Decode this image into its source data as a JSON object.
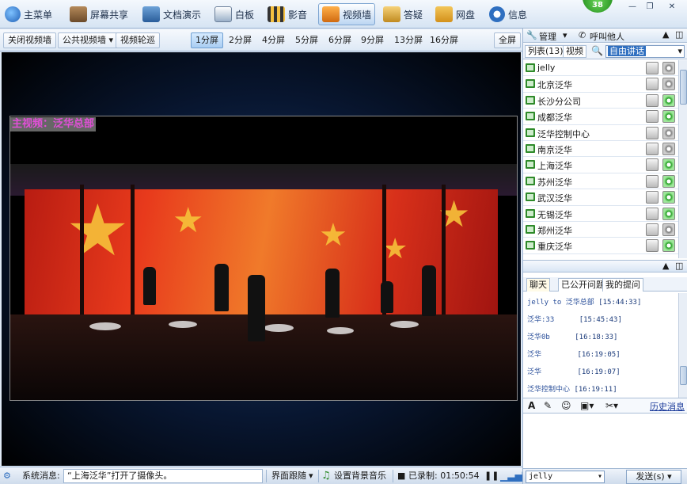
{
  "menu": {
    "items": [
      {
        "label": "主菜单",
        "icon": "main-menu-icon"
      },
      {
        "label": "屏幕共享",
        "icon": "screen-share-icon"
      },
      {
        "label": "文档演示",
        "icon": "document-icon"
      },
      {
        "label": "白板",
        "icon": "whiteboard-icon"
      },
      {
        "label": "影音",
        "icon": "film-icon"
      },
      {
        "label": "视频墙",
        "icon": "video-wall-icon"
      },
      {
        "label": "答疑",
        "icon": "qa-icon"
      },
      {
        "label": "网盘",
        "icon": "cloud-disk-icon"
      },
      {
        "label": "信息",
        "icon": "info-icon"
      }
    ],
    "active": "视频墙",
    "badge_count": "38"
  },
  "toolbar": {
    "close_wall": "关闭视频墙",
    "public_wall": "公共视频墙",
    "rotate": "视频轮巡",
    "screens": [
      "1分屏",
      "2分屏",
      "4分屏",
      "5分屏",
      "6分屏",
      "9分屏",
      "13分屏",
      "16分屏"
    ],
    "selected_screen": "1分屏",
    "fullscreen": "全屏"
  },
  "video": {
    "label": "主视频：泛华总部"
  },
  "statusbar": {
    "sys_label": "系统消息:",
    "sys_msg": "“上海泛华”打开了摄像头。",
    "follow": "界面跟随",
    "bg_music": "设置背景音乐",
    "recorded": "已录制: 01:50:54"
  },
  "right_panel": {
    "manage": "管理",
    "call": "呼叫他人",
    "list_tab": "列表(13)",
    "video_tab": "视频",
    "talk_mode": "自由讲话",
    "users": [
      {
        "name": "jelly",
        "cam": false
      },
      {
        "name": "北京泛华",
        "cam": false
      },
      {
        "name": "长沙分公司",
        "cam": true
      },
      {
        "name": "成都泛华",
        "cam": true
      },
      {
        "name": "泛华控制中心",
        "cam": false
      },
      {
        "name": "南京泛华",
        "cam": false
      },
      {
        "name": "上海泛华",
        "cam": true
      },
      {
        "name": "苏州泛华",
        "cam": true
      },
      {
        "name": "武汉泛华",
        "cam": true
      },
      {
        "name": "无锡泛华",
        "cam": true
      },
      {
        "name": "郑州泛华",
        "cam": false
      },
      {
        "name": "重庆泛华",
        "cam": true
      }
    ],
    "chat_tabs": [
      "聊天",
      "已公开问题",
      "我的提问"
    ],
    "chat": [
      {
        "who": "jelly to 泛华总部",
        "time": "[15:44:33]"
      },
      {
        "who": "泛华:33",
        "time": "[15:45:43]"
      },
      {
        "who": "泛华0b",
        "time": "[16:18:33]"
      },
      {
        "who": "泛华",
        "time": "[16:19:05]"
      },
      {
        "who": "泛华",
        "time": "[16:19:07]"
      },
      {
        "who": "泛华控制中心",
        "time": "[16:19:11]"
      }
    ],
    "history": "历史消息",
    "recipient": "jelly",
    "send": "发送(s)"
  }
}
